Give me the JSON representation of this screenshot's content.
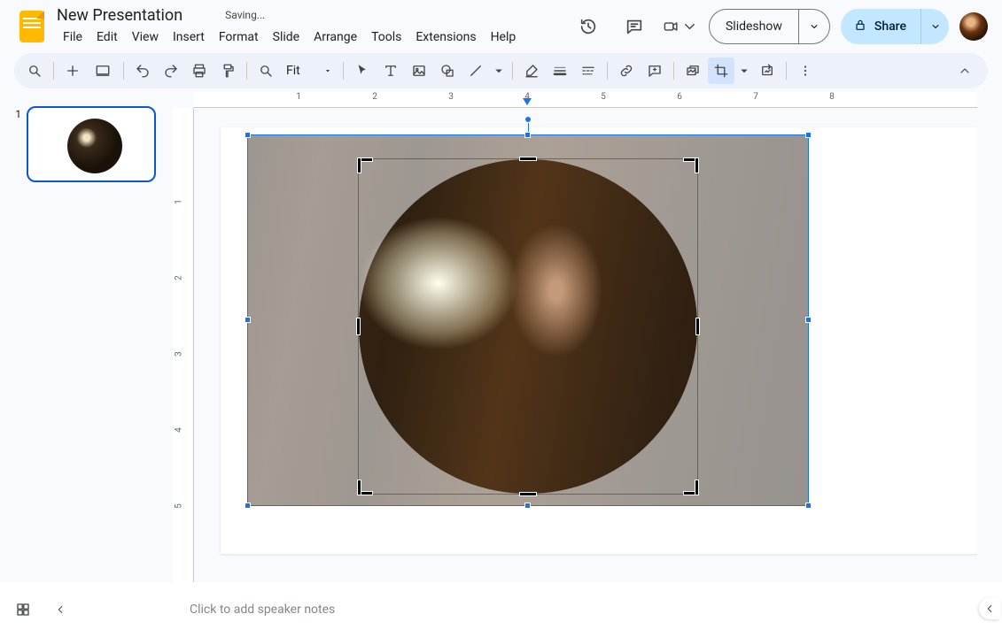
{
  "doc": {
    "title": "New Presentation",
    "status": "Saving..."
  },
  "menus": {
    "file": "File",
    "edit": "Edit",
    "view": "View",
    "insert": "Insert",
    "format": "Format",
    "slide": "Slide",
    "arrange": "Arrange",
    "tools": "Tools",
    "extensions": "Extensions",
    "help": "Help"
  },
  "actions": {
    "slideshow": "Slideshow",
    "share": "Share"
  },
  "toolbar": {
    "zoom": "Fit"
  },
  "ruler_h": {
    "t1": "1",
    "t2": "2",
    "t3": "3",
    "t4": "4",
    "t5": "5",
    "t6": "6",
    "t7": "7",
    "t8": "8"
  },
  "ruler_v": {
    "t1": "1",
    "t2": "2",
    "t3": "3",
    "t4": "4",
    "t5": "5"
  },
  "thumbs": {
    "n1": "1"
  },
  "notes": {
    "placeholder": "Click to add speaker notes"
  }
}
